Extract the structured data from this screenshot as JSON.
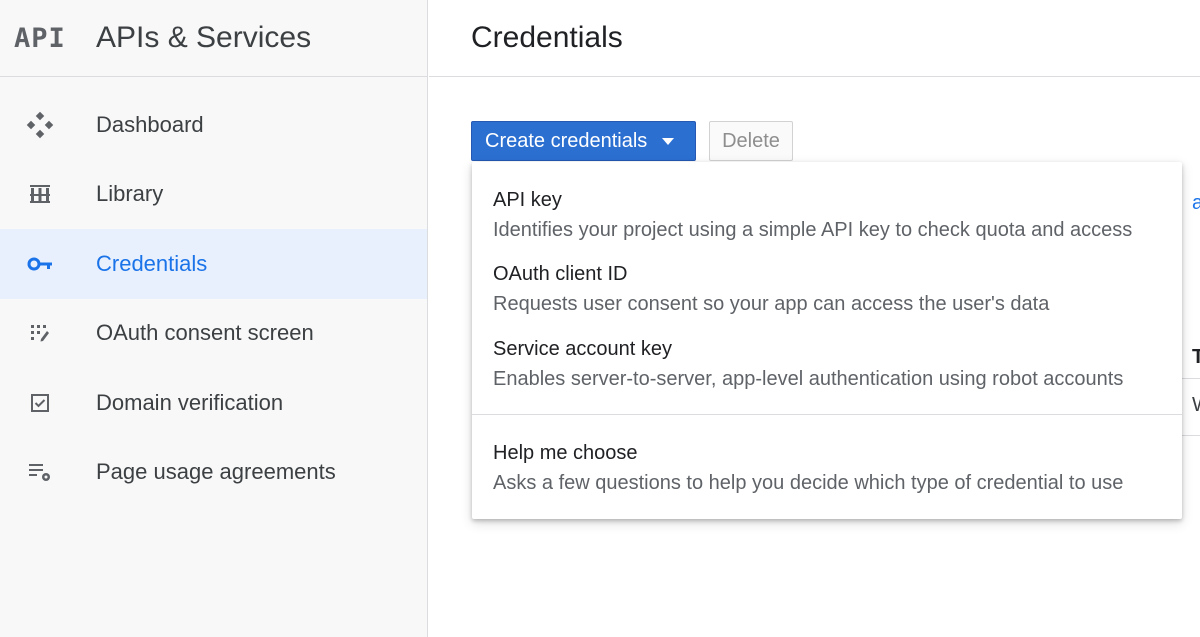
{
  "sidebar": {
    "logo": "API",
    "product_name": "APIs & Services",
    "items": [
      {
        "label": "Dashboard",
        "icon": "dashboard-icon",
        "active": false
      },
      {
        "label": "Library",
        "icon": "library-icon",
        "active": false
      },
      {
        "label": "Credentials",
        "icon": "key-icon",
        "active": true
      },
      {
        "label": "OAuth consent screen",
        "icon": "consent-screen-icon",
        "active": false
      },
      {
        "label": "Domain verification",
        "icon": "checkbox-icon",
        "active": false
      },
      {
        "label": "Page usage agreements",
        "icon": "list-settings-icon",
        "active": false
      }
    ]
  },
  "header": {
    "title": "Credentials"
  },
  "toolbar": {
    "create_label": "Create credentials",
    "delete_label": "Delete"
  },
  "dropdown": {
    "items": [
      {
        "title": "API key",
        "description": "Identifies your project using a simple API key to check quota and access"
      },
      {
        "title": "OAuth client ID",
        "description": "Requests user consent so your app can access the user's data"
      },
      {
        "title": "Service account key",
        "description": "Enables server-to-server, app-level authentication using robot accounts"
      },
      {
        "title": "Help me choose",
        "description": "Asks a few questions to help you decide which type of credential to use"
      }
    ]
  },
  "background": {
    "partial_link": "a",
    "partial_header": "T",
    "partial_cell": "W"
  },
  "colors": {
    "accent": "#1a73e8",
    "primary_button": "#2b6fd1",
    "active_nav_bg": "#e8f0fe",
    "sidebar_bg": "#f8f8f8"
  }
}
